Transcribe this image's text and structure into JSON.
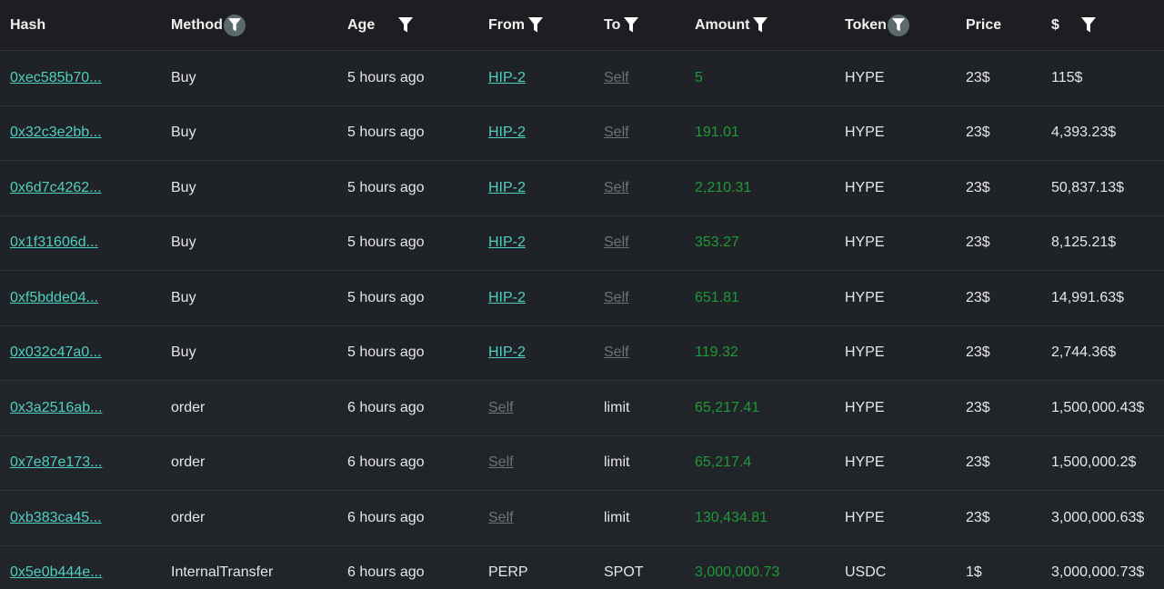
{
  "columns": {
    "hash": "Hash",
    "method": "Method",
    "age": "Age",
    "from": "From",
    "to": "To",
    "amount": "Amount",
    "token": "Token",
    "price": "Price",
    "usd": "$"
  },
  "icons": {
    "filter": "filter-icon"
  },
  "colors": {
    "link": "#4fcfc0",
    "amount": "#1f9a36",
    "self": "#6e7378",
    "filter_badge": "#5c6b69"
  },
  "rows": [
    {
      "hash": "0xec585b70...",
      "method": "Buy",
      "age": "5 hours ago",
      "from": "HIP-2",
      "to": "Self",
      "amount": "5",
      "token": "HYPE",
      "price": "23$",
      "usd": "115$"
    },
    {
      "hash": "0x32c3e2bb...",
      "method": "Buy",
      "age": "5 hours ago",
      "from": "HIP-2",
      "to": "Self",
      "amount": "191.01",
      "token": "HYPE",
      "price": "23$",
      "usd": "4,393.23$"
    },
    {
      "hash": "0x6d7c4262...",
      "method": "Buy",
      "age": "5 hours ago",
      "from": "HIP-2",
      "to": "Self",
      "amount": "2,210.31",
      "token": "HYPE",
      "price": "23$",
      "usd": "50,837.13$"
    },
    {
      "hash": "0x1f31606d...",
      "method": "Buy",
      "age": "5 hours ago",
      "from": "HIP-2",
      "to": "Self",
      "amount": "353.27",
      "token": "HYPE",
      "price": "23$",
      "usd": "8,125.21$"
    },
    {
      "hash": "0xf5bdde04...",
      "method": "Buy",
      "age": "5 hours ago",
      "from": "HIP-2",
      "to": "Self",
      "amount": "651.81",
      "token": "HYPE",
      "price": "23$",
      "usd": "14,991.63$"
    },
    {
      "hash": "0x032c47a0...",
      "method": "Buy",
      "age": "5 hours ago",
      "from": "HIP-2",
      "to": "Self",
      "amount": "119.32",
      "token": "HYPE",
      "price": "23$",
      "usd": "2,744.36$"
    },
    {
      "hash": "0x3a2516ab...",
      "method": "order",
      "age": "6 hours ago",
      "from": "Self",
      "to": "limit",
      "amount": "65,217.41",
      "token": "HYPE",
      "price": "23$",
      "usd": "1,500,000.43$"
    },
    {
      "hash": "0x7e87e173...",
      "method": "order",
      "age": "6 hours ago",
      "from": "Self",
      "to": "limit",
      "amount": "65,217.4",
      "token": "HYPE",
      "price": "23$",
      "usd": "1,500,000.2$"
    },
    {
      "hash": "0xb383ca45...",
      "method": "order",
      "age": "6 hours ago",
      "from": "Self",
      "to": "limit",
      "amount": "130,434.81",
      "token": "HYPE",
      "price": "23$",
      "usd": "3,000,000.63$"
    },
    {
      "hash": "0x5e0b444e...",
      "method": "InternalTransfer",
      "age": "6 hours ago",
      "from": "PERP",
      "to": "SPOT",
      "amount": "3,000,000.73",
      "token": "USDC",
      "price": "1$",
      "usd": "3,000,000.73$"
    }
  ]
}
